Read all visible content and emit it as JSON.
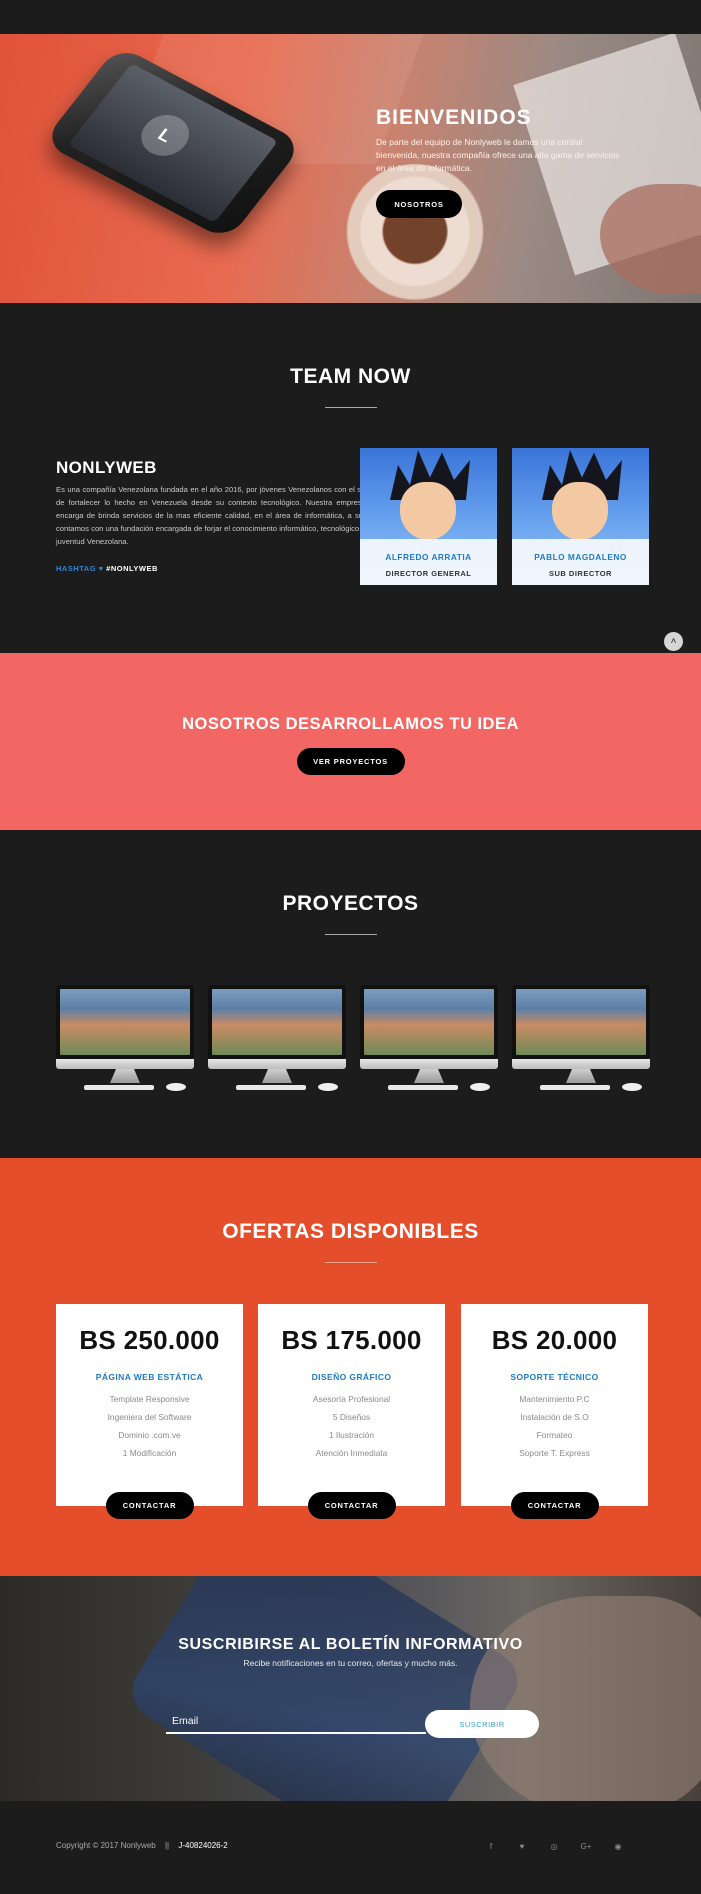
{
  "hero": {
    "title": "BIENVENIDOS",
    "description": "De parte del equipo de Nonlyweb le damos una cordial bienvenida, nuestra compañía ofrece una alta gama de servicios en el área de informática.",
    "button": "NOSOTROS",
    "phone_logo": "L"
  },
  "team": {
    "title": "TEAM NOW",
    "about_title": "NONLYWEB",
    "about_text": "Es una compañía Venezolana fundada en el año 2016, por jóvenes Venezolanos con el sueño de fortalecer lo hecho en Venezuela desde su contexto tecnológico. Nuestra empresa se encarga de brinda servicios de la mas eficiente calidad, en el área de informática, a su vez contamos con una fundación encargada de forjar el conocimiento informático, tecnológico en la juventud Venezolana.",
    "hashtag_label": "HASHTAG",
    "hashtag_icon": "heart-icon",
    "hashtag_value": "#NONLYWEB",
    "members": [
      {
        "name": "ALFREDO ARRATIA",
        "role": "DIRECTOR GENERAL"
      },
      {
        "name": "PABLO MAGDALENO",
        "role": "SUB DIRECTOR"
      }
    ]
  },
  "cta": {
    "title": "NOSOTROS DESARROLLAMOS TU IDEA",
    "button": "VER PROYECTOS"
  },
  "projects": {
    "title": "PROYECTOS",
    "count": 4
  },
  "offers": {
    "title": "OFERTAS DISPONIBLES",
    "plans": [
      {
        "price": "BS 250.000",
        "name": "PÁGINA WEB ESTÁTICA",
        "features": [
          "Template Responsive",
          "Ingeniera del Software",
          "Dominio .com.ve",
          "1 Modificación"
        ],
        "button": "CONTACTAR"
      },
      {
        "price": "BS 175.000",
        "name": "DISEÑO GRÁFICO",
        "features": [
          "Asesoría Profesional",
          "5 Diseños",
          "1 Ilustración",
          "Atención Inmediata"
        ],
        "button": "CONTACTAR"
      },
      {
        "price": "BS 20.000",
        "name": "SOPORTE TÉCNICO",
        "features": [
          "Mantenimiento P.C",
          "Instalación de S.O",
          "Formateo",
          "Soporte T. Express"
        ],
        "button": "CONTACTAR"
      }
    ]
  },
  "newsletter": {
    "title": "SUSCRIBIRSE AL BOLETÍN INFORMATIVO",
    "subtitle": "Recibe notificaciones en tu correo, ofertas y mucho más.",
    "email_placeholder": "Email",
    "button": "SUSCRIBIR"
  },
  "footer": {
    "copyright": "Copyright © 2017 Nonlyweb",
    "separator": "||",
    "rif": "J-40824026-2",
    "social": [
      {
        "icon": "facebook-icon",
        "glyph": "f"
      },
      {
        "icon": "twitter-icon",
        "glyph": "♥"
      },
      {
        "icon": "instagram-icon",
        "glyph": "◎"
      },
      {
        "icon": "google-plus-icon",
        "glyph": "G+"
      },
      {
        "icon": "telegram-icon",
        "glyph": "◉"
      }
    ]
  },
  "colors": {
    "hero_orange": "#e0533a",
    "cta_coral": "#f26663",
    "offers_orange": "#e44e2a",
    "accent_blue": "#1f7bc7",
    "dark_bg": "#1c1c1d"
  }
}
